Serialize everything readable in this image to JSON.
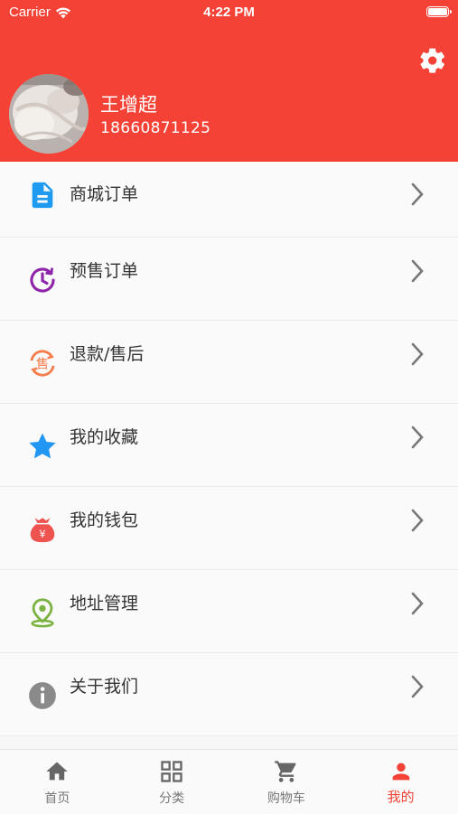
{
  "status_bar": {
    "carrier": "Carrier",
    "time": "4:22 PM"
  },
  "colors": {
    "header_bg": "#f44336",
    "tab_active": "#f44336",
    "tab_inactive": "#757575"
  },
  "user": {
    "name": "王增超",
    "phone": "18660871125"
  },
  "menu": {
    "items": [
      {
        "label": "商城订单",
        "icon": "document-icon"
      },
      {
        "label": "预售订单",
        "icon": "clock-icon"
      },
      {
        "label": "退款/售后",
        "icon": "refund-icon"
      },
      {
        "label": "我的收藏",
        "icon": "star-icon"
      },
      {
        "label": "我的钱包",
        "icon": "wallet-icon"
      },
      {
        "label": "地址管理",
        "icon": "location-icon"
      },
      {
        "label": "关于我们",
        "icon": "info-icon"
      }
    ]
  },
  "tabbar": {
    "tabs": [
      {
        "label": "首页",
        "icon": "home-icon"
      },
      {
        "label": "分类",
        "icon": "grid-icon"
      },
      {
        "label": "购物车",
        "icon": "cart-icon"
      },
      {
        "label": "我的",
        "icon": "person-icon",
        "active": true
      }
    ]
  }
}
